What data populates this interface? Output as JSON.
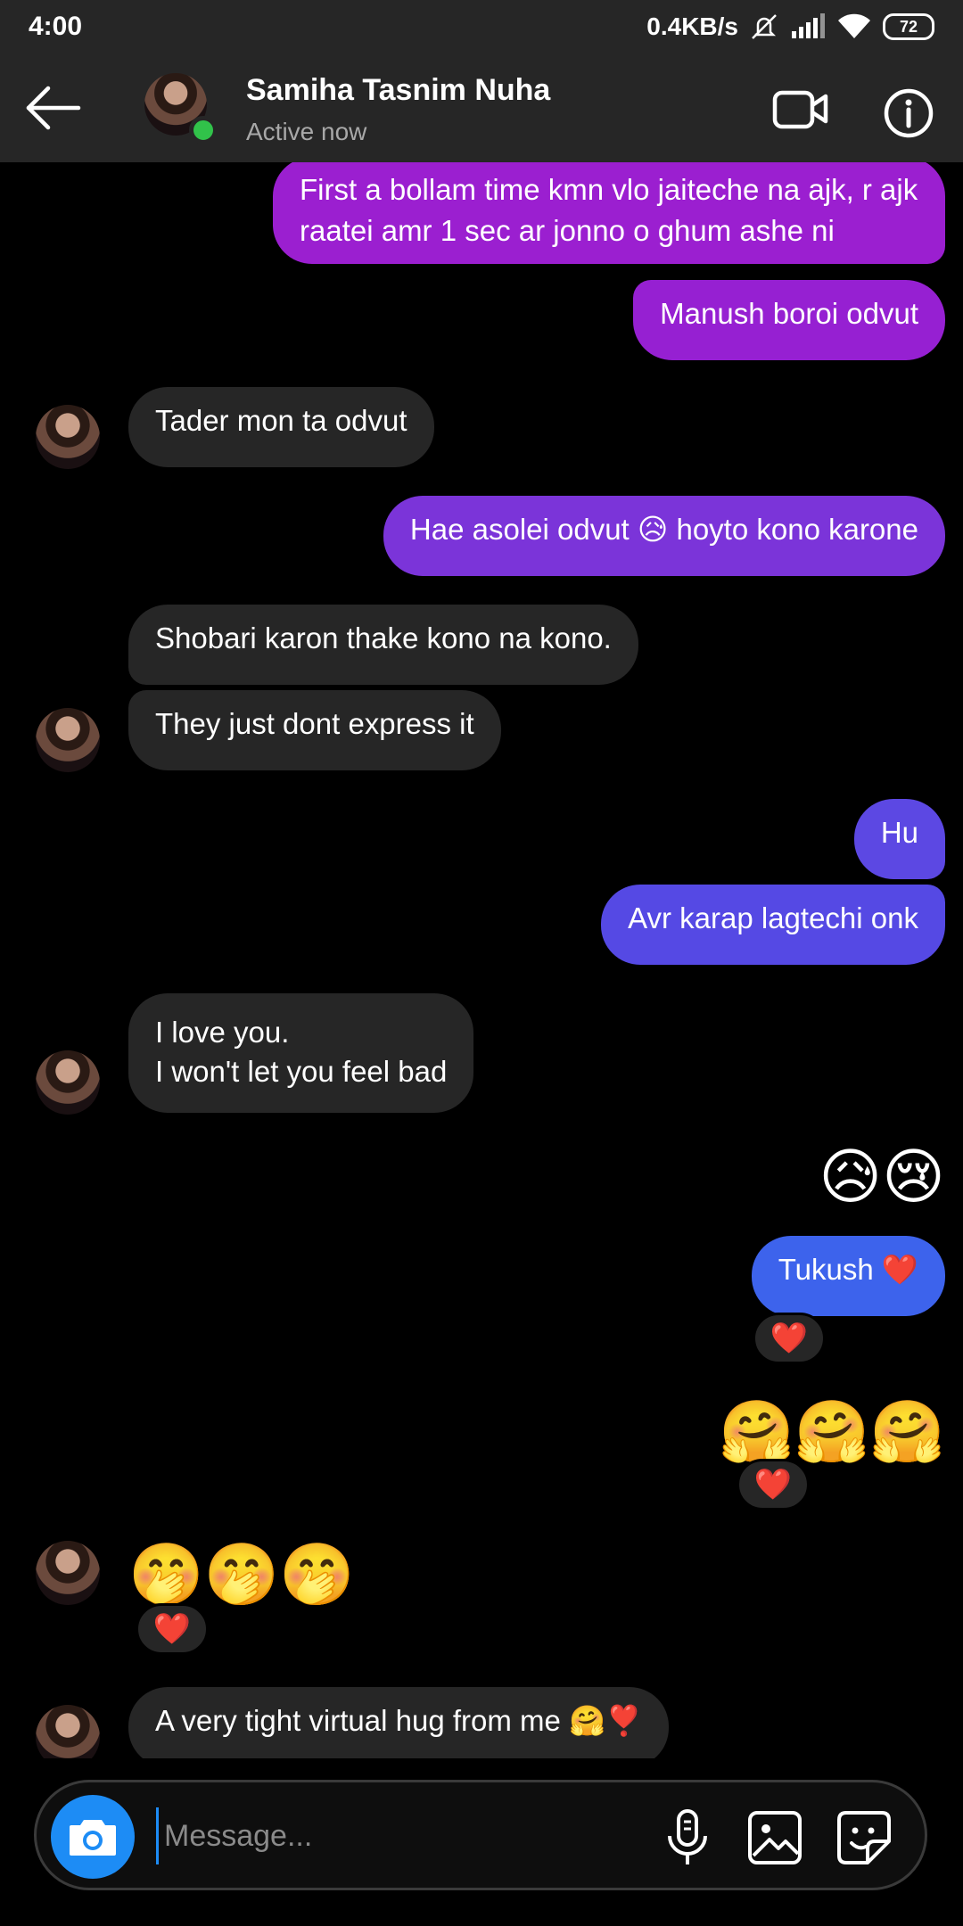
{
  "status_bar": {
    "time": "4:00",
    "network_speed": "0.4KB/s",
    "battery": "72",
    "icons": [
      "mute-icon",
      "signal-icon",
      "wifi-icon",
      "battery-icon"
    ]
  },
  "header": {
    "name": "Samiha Tasnim Nuha",
    "status": "Active now",
    "icons": [
      "back-arrow-icon",
      "video-call-icon",
      "info-icon"
    ]
  },
  "colors": {
    "background": "#000000",
    "incoming_bubble": "#262626",
    "outgoing_purple": "#9b1fd0",
    "outgoing_violet": "#7b34d9",
    "outgoing_indigo": "#5a48e3",
    "outgoing_blue": "#3d63ec",
    "online": "#31c24a",
    "camera_button": "#1d8cf5"
  },
  "messages": [
    {
      "side": "out",
      "text": "First a bollam time kmn vlo jaiteche na ajk, r ajk raatei amr 1 sec ar jonno o ghum ashe ni"
    },
    {
      "side": "out",
      "text": "Manush boroi odvut"
    },
    {
      "side": "in",
      "text": "Tader mon ta odvut"
    },
    {
      "side": "out",
      "text": "Hae asolei odvut 😥 hoyto kono karone"
    },
    {
      "side": "in",
      "text": "Shobari karon thake kono na kono."
    },
    {
      "side": "in",
      "text": "They just dont express it"
    },
    {
      "side": "out",
      "text": "Hu"
    },
    {
      "side": "out",
      "text": "Avr karap lagtechi onk"
    },
    {
      "side": "in",
      "text": "I love you.\nI won't let you feel bad"
    },
    {
      "side": "out",
      "text": "😥😢",
      "type": "emoji"
    },
    {
      "side": "out",
      "text": "Tukush ❤️",
      "reaction": "❤️"
    },
    {
      "side": "out",
      "text": "🤗🤗🤗",
      "type": "emoji",
      "reaction": "❤️"
    },
    {
      "side": "in",
      "text": "🤭🤭🤭",
      "type": "emoji",
      "reaction": "❤️"
    },
    {
      "side": "in",
      "text": "A very tight virtual hug from me 🤗❣️"
    }
  ],
  "composer": {
    "placeholder": "Message...",
    "icons": [
      "camera-icon",
      "microphone-icon",
      "gallery-icon",
      "sticker-icon"
    ]
  }
}
